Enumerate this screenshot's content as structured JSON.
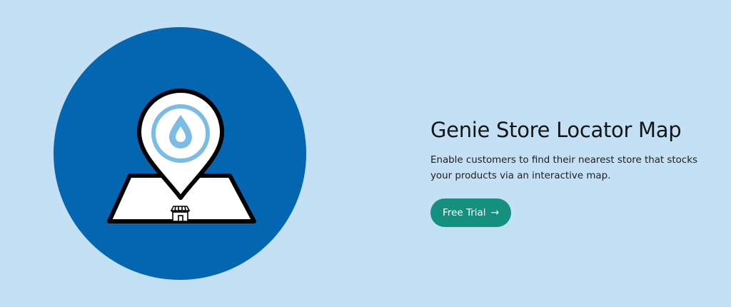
{
  "hero": {
    "title": "Genie Store Locator Map",
    "description": "Enable customers to find their nearest store that stocks your products via an interactive map.",
    "cta_label": "Free Trial",
    "cta_arrow": "→"
  },
  "illustration": {
    "icon": "map-pin-store-icon",
    "circle_color": "#0466b0",
    "drop_color": "#7bbce6",
    "outline_color": "#000000"
  },
  "colors": {
    "background": "#c4e0f4",
    "button": "#15907e",
    "button_text": "#ffffff",
    "title": "#151515"
  }
}
